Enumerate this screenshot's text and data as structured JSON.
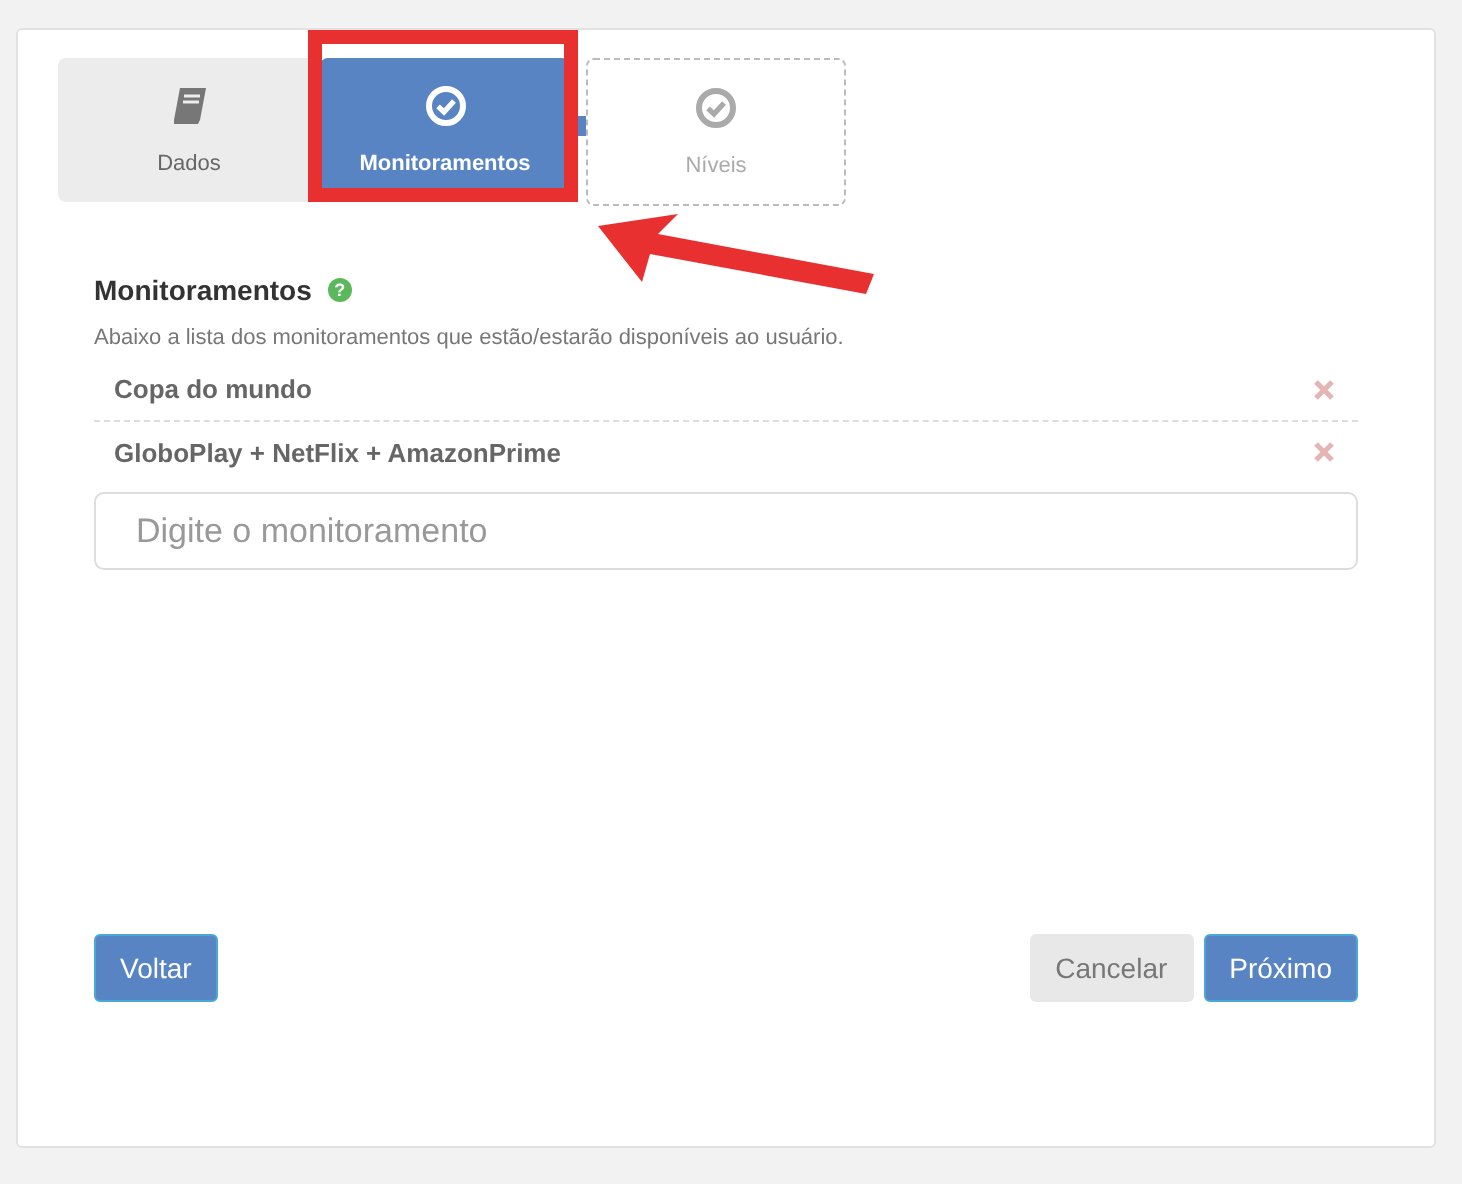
{
  "steps": [
    {
      "label": "Dados",
      "kind": "done",
      "selected": false
    },
    {
      "label": "Monitoramentos",
      "kind": "todo",
      "selected": true
    },
    {
      "label": "Níveis",
      "kind": "todo",
      "selected": false
    }
  ],
  "section": {
    "title": "Monitoramentos",
    "help": "?",
    "description": "Abaixo a lista dos monitoramentos que estão/estarão disponíveis ao usuário."
  },
  "items": [
    {
      "label": "Copa do mundo"
    },
    {
      "label": "GloboPlay + NetFlix + AmazonPrime"
    }
  ],
  "input": {
    "placeholder": "Digite o monitoramento"
  },
  "buttons": [
    {
      "label": "Voltar",
      "kind": "primary"
    },
    {
      "label": "Cancelar",
      "kind": "secondary"
    },
    {
      "label": "Próximo",
      "kind": "primary"
    }
  ]
}
